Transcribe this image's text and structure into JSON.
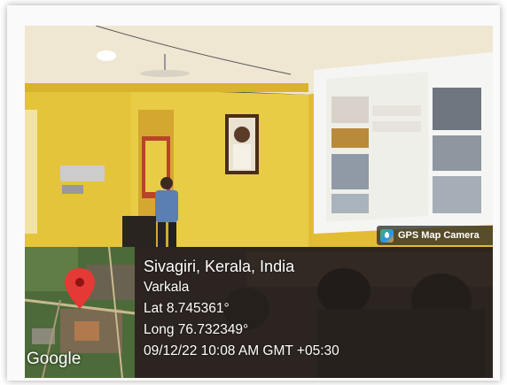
{
  "watermark": {
    "app_name": "GPS Map Camera",
    "app_icon": "gps-map-camera-logo-icon"
  },
  "map": {
    "brand": "Google",
    "marker_icon": "map-pin-icon",
    "pin_color": "#e53935"
  },
  "location": {
    "place": "Sivagiri, Kerala, India",
    "city": "Varkala",
    "latitude": "Lat 8.745361°",
    "longitude": "Long 76.732349°",
    "timestamp": "09/12/22 10:08 AM GMT +05:30"
  },
  "scene": {
    "wall_color": "#e6c83a",
    "ceiling_color": "#f2ebd7",
    "projection_color": "#f4f4f2"
  }
}
